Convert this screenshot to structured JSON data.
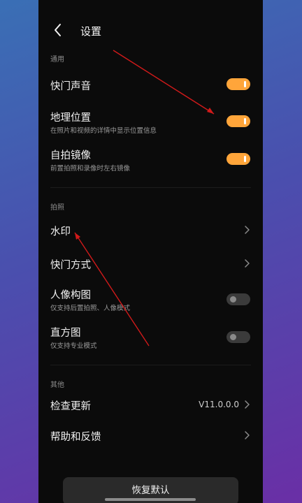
{
  "header": {
    "title": "设置",
    "back_icon": "chevron-left-icon"
  },
  "sections": {
    "general": "通用",
    "photo": "拍照",
    "other": "其他"
  },
  "settings": {
    "shutter_sound": {
      "label": "快门声音",
      "enabled": true
    },
    "location": {
      "label": "地理位置",
      "desc": "在照片和视频的详情中显示位置信息",
      "enabled": true
    },
    "selfie_mirror": {
      "label": "自拍镜像",
      "desc": "前置拍照和录像时左右镜像",
      "enabled": true
    },
    "watermark": {
      "label": "水印"
    },
    "shutter_mode": {
      "label": "快门方式"
    },
    "portrait_composition": {
      "label": "人像构图",
      "desc": "仅支持后置拍照、人像模式",
      "enabled": false
    },
    "histogram": {
      "label": "直方图",
      "desc": "仅支持专业模式",
      "enabled": false
    },
    "check_update": {
      "label": "检查更新",
      "value": "V11.0.0.0"
    },
    "help_feedback": {
      "label": "帮助和反馈"
    }
  },
  "reset_button": {
    "label": "恢复默认"
  },
  "colors": {
    "toggle_on": "#ffa53a",
    "annotation_arrow": "#d11a1a",
    "background": "#0b0b0b"
  }
}
